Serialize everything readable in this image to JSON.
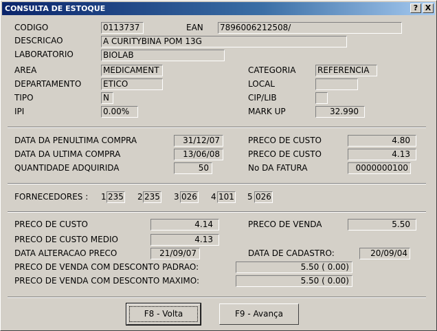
{
  "window": {
    "title": "CONSULTA DE ESTOQUE",
    "help_label": "?",
    "close_label": "X"
  },
  "product": {
    "codigo_label": "CODIGO",
    "codigo": "0113737",
    "ean_label": "EAN",
    "ean": "7896006212508/",
    "descricao_label": "DESCRICAO",
    "descricao": "A CURITYBINA POM 13G",
    "laboratorio_label": "LABORATORIO",
    "laboratorio": "BIOLAB",
    "area_label": "AREA",
    "area": "MEDICAMENT",
    "categoria_label": "CATEGORIA",
    "categoria": "REFERENCIA",
    "departamento_label": "DEPARTAMENTO",
    "departamento": "ETICO",
    "local_label": "LOCAL",
    "local": "",
    "tipo_label": "TIPO",
    "tipo": "N",
    "ciplib_label": "CIP/LIB",
    "ciplib": "",
    "ipi_label": "IPI",
    "ipi": "0.00%",
    "markup_label": "MARK UP",
    "markup": "32.990"
  },
  "purchases": {
    "penultima_label": "DATA DA PENULTIMA COMPRA",
    "penultima": "31/12/07",
    "preco_custo_label_1": "PRECO DE CUSTO",
    "preco_custo_1": "4.80",
    "ultima_label": "DATA DA ULTIMA COMPRA",
    "ultima": "13/06/08",
    "preco_custo_label_2": "PRECO DE CUSTO",
    "preco_custo_2": "4.13",
    "quantidade_label": "QUANTIDADE ADQUIRIDA",
    "quantidade": "50",
    "fatura_label": "No DA FATURA",
    "fatura": "0000000100"
  },
  "suppliers": {
    "label": "FORNECEDORES :",
    "items": [
      {
        "num": "1",
        "code": "235"
      },
      {
        "num": "2",
        "code": "235"
      },
      {
        "num": "3",
        "code": "026"
      },
      {
        "num": "4",
        "code": "101"
      },
      {
        "num": "5",
        "code": "026"
      }
    ]
  },
  "prices": {
    "custo_label": "PRECO DE CUSTO",
    "custo": "4.14",
    "venda_label": "PRECO DE VENDA",
    "venda": "5.50",
    "custo_medio_label": "PRECO DE CUSTO MEDIO",
    "custo_medio": "4.13",
    "alteracao_label": "DATA ALTERACAO PRECO",
    "alteracao": "21/09/07",
    "cadastro_label": "DATA DE CADASTRO:",
    "cadastro": "20/09/04",
    "desc_padrao_label": "PRECO DE VENDA COM DESCONTO PADRAO:",
    "desc_padrao": "5.50 ( 0.00)",
    "desc_maximo_label": "PRECO DE VENDA COM DESCONTO MAXIMO:",
    "desc_maximo": "5.50 ( 0.00)"
  },
  "buttons": {
    "volta": "F8 - Volta",
    "avanca": "F9 - Avança"
  }
}
